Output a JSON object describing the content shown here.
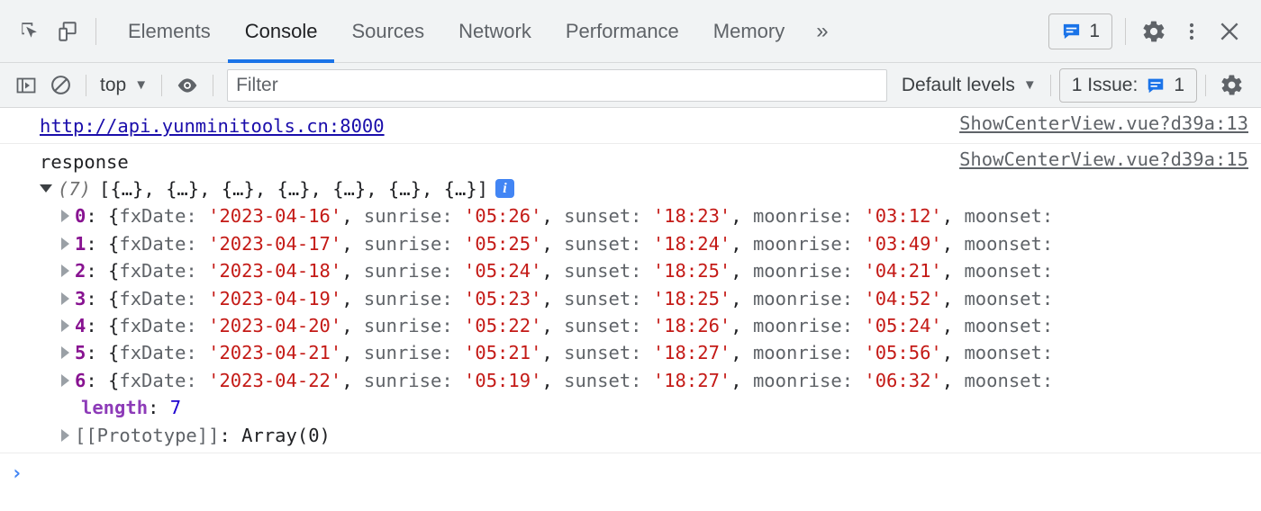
{
  "window": {
    "title": "Chrome DevTools - Console"
  },
  "toolbar": {
    "inspect_icon": "inspect-element-icon",
    "device_icon": "device-toolbar-icon",
    "tabs": [
      {
        "label": "Elements",
        "active": false
      },
      {
        "label": "Console",
        "active": true
      },
      {
        "label": "Sources",
        "active": false
      },
      {
        "label": "Network",
        "active": false
      },
      {
        "label": "Performance",
        "active": false
      },
      {
        "label": "Memory",
        "active": false
      }
    ],
    "more_tabs_label": "»",
    "message_count": "1",
    "message_icon": "message-bubble-icon",
    "settings_icon": "gear-icon",
    "more_options_icon": "three-dot-menu-icon",
    "close_icon": "close-icon",
    "accent_color": "#1a73e8"
  },
  "filterbar": {
    "sidebar_toggle_icon": "console-sidebar-icon",
    "clear_icon": "clear-console-icon",
    "context_value": "top",
    "eye_icon": "live-expression-eye-icon",
    "filter_placeholder": "Filter",
    "filter_value": "",
    "levels_value": "Default levels",
    "issues_label": "1 Issue:",
    "issues_count": "1",
    "issues_icon": "message-bubble-icon",
    "settings_icon": "gear-icon",
    "caret": "▼"
  },
  "console": {
    "messages": [
      {
        "text": "http://api.yunminitools.cn:8000",
        "kind": "link",
        "source": "ShowCenterView.vue?d39a:13"
      },
      {
        "text": "response",
        "kind": "text",
        "source": "ShowCenterView.vue?d39a:15"
      }
    ],
    "array": {
      "count_label": "(7)",
      "preview": "[{…}, {…}, {…}, {…}, {…}, {…}, {…}]",
      "info_icon": "info-icon",
      "expanded": true,
      "items": [
        {
          "index": "0",
          "fxDate": "'2023-04-16'",
          "sunrise": "'05:26'",
          "sunset": "'18:23'",
          "moonrise": "'03:12'"
        },
        {
          "index": "1",
          "fxDate": "'2023-04-17'",
          "sunrise": "'05:25'",
          "sunset": "'18:24'",
          "moonrise": "'03:49'"
        },
        {
          "index": "2",
          "fxDate": "'2023-04-18'",
          "sunrise": "'05:24'",
          "sunset": "'18:25'",
          "moonrise": "'04:21'"
        },
        {
          "index": "3",
          "fxDate": "'2023-04-19'",
          "sunrise": "'05:23'",
          "sunset": "'18:25'",
          "moonrise": "'04:52'"
        },
        {
          "index": "4",
          "fxDate": "'2023-04-20'",
          "sunrise": "'05:22'",
          "sunset": "'18:26'",
          "moonrise": "'05:24'"
        },
        {
          "index": "5",
          "fxDate": "'2023-04-21'",
          "sunrise": "'05:21'",
          "sunset": "'18:27'",
          "moonrise": "'05:56'"
        },
        {
          "index": "6",
          "fxDate": "'2023-04-22'",
          "sunrise": "'05:19'",
          "sunset": "'18:27'",
          "moonrise": "'06:32'"
        }
      ],
      "prop_labels": {
        "open_brace": "{",
        "fxDate": "fxDate:",
        "sunrise": "sunrise:",
        "sunset": "sunset:",
        "moonrise": "moonrise:",
        "moonset": "moonset:",
        "comma": ","
      },
      "length_key": "length",
      "length_value": "7",
      "prototype_key": "[[Prototype]]",
      "prototype_value": "Array(0)"
    }
  },
  "prompt": {
    "chevron": "›",
    "value": ""
  }
}
